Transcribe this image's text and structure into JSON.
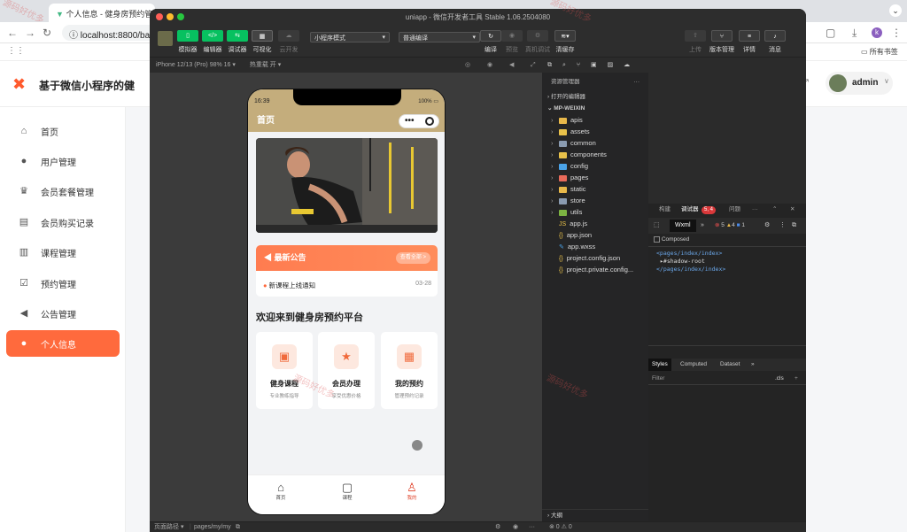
{
  "browser": {
    "tab_title": "个人信息 - 健身房预约管理系统",
    "url": "localhost:8800/bac",
    "bookmarks": "所有书签",
    "avatar_letter": "k"
  },
  "admin": {
    "brand": "基于微信小程序的健",
    "user": "admin",
    "menu": [
      {
        "label": "首页",
        "icon": "⌂"
      },
      {
        "label": "用户管理",
        "icon": "●"
      },
      {
        "label": "会员套餐管理",
        "icon": "♛"
      },
      {
        "label": "会员购买记录",
        "icon": "▤"
      },
      {
        "label": "课程管理",
        "icon": "▥"
      },
      {
        "label": "预约管理",
        "icon": "☑"
      },
      {
        "label": "公告管理",
        "icon": "◀"
      },
      {
        "label": "个人信息",
        "icon": "●"
      }
    ],
    "active_index": 7
  },
  "devtools": {
    "window_title": "uniapp - 微信开发者工具 Stable 1.06.2504080",
    "toolbar": {
      "simulator": "模拟器",
      "editor": "编辑器",
      "debugger": "调试器",
      "visual": "可视化",
      "cloud": "云开发",
      "mode": "小程序模式",
      "compile_mode": "普通编译",
      "compile": "编译",
      "preview": "预览",
      "real_debug": "真机调试",
      "clear_cache": "清缓存",
      "upload": "上传",
      "version": "版本管理",
      "details": "详情",
      "messages": "消息"
    },
    "sim_device": "iPhone 12/13 (Pro) 98% 16 ▾",
    "hot_reload": "热重载 开 ▾",
    "status_path_label": "页面路径 ▾",
    "status_path": "pages/my/my",
    "status_counts": "⊗ 0 ⚠ 0",
    "explorer": {
      "title": "资源管理器",
      "open_editors": "打开的编辑器",
      "project": "MP-WEIXIN",
      "items": [
        {
          "name": "apis",
          "type": "folder",
          "color": "#e8b84a"
        },
        {
          "name": "assets",
          "type": "folder",
          "color": "#e8c14a"
        },
        {
          "name": "common",
          "type": "folder",
          "color": "#8a9bb0"
        },
        {
          "name": "components",
          "type": "folder",
          "color": "#e8c14a"
        },
        {
          "name": "config",
          "type": "folder",
          "color": "#4aa3e8"
        },
        {
          "name": "pages",
          "type": "folder",
          "color": "#e86a5a"
        },
        {
          "name": "static",
          "type": "folder",
          "color": "#e8b84a"
        },
        {
          "name": "store",
          "type": "folder",
          "color": "#8a9bb0"
        },
        {
          "name": "utils",
          "type": "folder",
          "color": "#7cb342"
        },
        {
          "name": "app.js",
          "type": "js",
          "color": "#e8c14a"
        },
        {
          "name": "app.json",
          "type": "json",
          "color": "#e8c14a"
        },
        {
          "name": "app.wxss",
          "type": "wxss",
          "color": "#4aa3e8"
        },
        {
          "name": "project.config.json",
          "type": "json",
          "color": "#e8c14a"
        },
        {
          "name": "project.private.config...",
          "type": "json",
          "color": "#e8c14a"
        }
      ],
      "outline": "大纲"
    },
    "debug": {
      "tabs": [
        "构建",
        "调试器",
        "问题"
      ],
      "badge": "5, 4",
      "wxml_tab": "Wxml",
      "errors": "5",
      "warnings": "4",
      "info": "1",
      "composed": "Composed",
      "tree": [
        "<pages/index/index>",
        "▸#shadow-root",
        "</pages/index/index>"
      ],
      "style_tabs": [
        "Styles",
        "Computed",
        "Dataset"
      ],
      "filter": "Filter",
      "cls": ".cls"
    }
  },
  "phone": {
    "time": "16:39",
    "battery": "100%",
    "nav_title": "首页",
    "notice_title": "最新公告",
    "notice_all": "查看全部 >",
    "notice_item": "新课程上线通知",
    "notice_date": "03-28",
    "welcome": "欢迎来到健身房预约平台",
    "cards": [
      {
        "title": "健身课程",
        "sub": "专业教练指导",
        "icon": "▣"
      },
      {
        "title": "会员办理",
        "sub": "享受优惠价格",
        "icon": "★"
      },
      {
        "title": "我的预约",
        "sub": "管理预约记录",
        "icon": "▦"
      }
    ],
    "tabs": [
      {
        "label": "首页",
        "icon": "⌂"
      },
      {
        "label": "课程",
        "icon": "▢"
      },
      {
        "label": "我的",
        "icon": "♙"
      }
    ]
  },
  "watermark": "源码好优多",
  "colors": {
    "accent": "#ff6a3d",
    "nav": "#c4ad7c"
  }
}
